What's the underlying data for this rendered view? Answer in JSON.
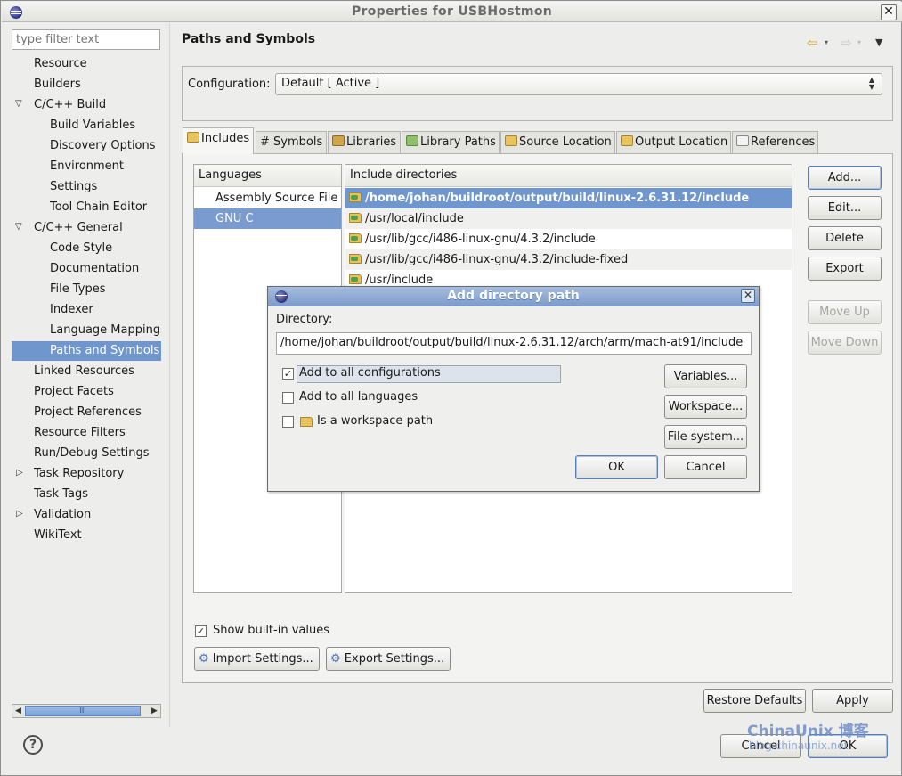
{
  "window": {
    "title": "Properties for USBHostmon",
    "close_label": "✕"
  },
  "filter": {
    "placeholder": "type filter text"
  },
  "tree": {
    "items": [
      {
        "label": "Resource"
      },
      {
        "label": "Builders"
      },
      {
        "label": "C/C++ Build"
      },
      {
        "label": "Build Variables"
      },
      {
        "label": "Discovery Options"
      },
      {
        "label": "Environment"
      },
      {
        "label": "Settings"
      },
      {
        "label": "Tool Chain Editor"
      },
      {
        "label": "C/C++ General"
      },
      {
        "label": "Code Style"
      },
      {
        "label": "Documentation"
      },
      {
        "label": "File Types"
      },
      {
        "label": "Indexer"
      },
      {
        "label": "Language Mappings"
      },
      {
        "label": "Paths and Symbols"
      },
      {
        "label": "Linked Resources"
      },
      {
        "label": "Project Facets"
      },
      {
        "label": "Project References"
      },
      {
        "label": "Resource Filters"
      },
      {
        "label": "Run/Debug Settings"
      },
      {
        "label": "Task Repository"
      },
      {
        "label": "Task Tags"
      },
      {
        "label": "Validation"
      },
      {
        "label": "WikiText"
      }
    ],
    "scroll_thumb": "III"
  },
  "page": {
    "title": "Paths and Symbols",
    "nav_back": "⇦",
    "nav_forward": "⇨",
    "nav_menu": "▼"
  },
  "config": {
    "label": "Configuration:",
    "value": "Default  [ Active ]"
  },
  "tabs": [
    {
      "label": "Includes"
    },
    {
      "label": "# Symbols"
    },
    {
      "label": "Libraries"
    },
    {
      "label": "Library Paths"
    },
    {
      "label": "Source Location"
    },
    {
      "label": "Output Location"
    },
    {
      "label": "References"
    }
  ],
  "languages": {
    "header": "Languages",
    "items": [
      "Assembly Source File",
      "GNU C"
    ]
  },
  "includes": {
    "header": "Include directories",
    "items": [
      "/home/johan/buildroot/output/build/linux-2.6.31.12/include",
      "/usr/local/include",
      "/usr/lib/gcc/i486-linux-gnu/4.3.2/include",
      "/usr/lib/gcc/i486-linux-gnu/4.3.2/include-fixed",
      "/usr/include"
    ]
  },
  "side_buttons": {
    "add": "Add...",
    "edit": "Edit...",
    "delete": "Delete",
    "export": "Export",
    "move_up": "Move Up",
    "move_down": "Move Down"
  },
  "show_builtin": {
    "label": "Show built-in values",
    "checked": true
  },
  "bottom_buttons": {
    "import": "Import Settings...",
    "export": "Export Settings..."
  },
  "footer": {
    "restore": "Restore Defaults",
    "apply": "Apply",
    "cancel": "Cancel",
    "ok": "OK",
    "help": "?"
  },
  "dialog": {
    "title": "Add directory path",
    "directory_label": "Directory:",
    "directory_value": "/home/johan/buildroot/output/build/linux-2.6.31.12/arch/arm/mach-at91/include",
    "options": [
      {
        "label": "Add to all configurations",
        "checked": true
      },
      {
        "label": "Add to all languages",
        "checked": false
      },
      {
        "label": "Is a workspace path",
        "checked": false
      }
    ],
    "buttons": {
      "variables": "Variables...",
      "workspace": "Workspace...",
      "filesystem": "File system...",
      "ok": "OK",
      "cancel": "Cancel"
    }
  },
  "watermark": {
    "brand": "ChinaUnix 博客",
    "url": "blog.chinaunix.net"
  }
}
